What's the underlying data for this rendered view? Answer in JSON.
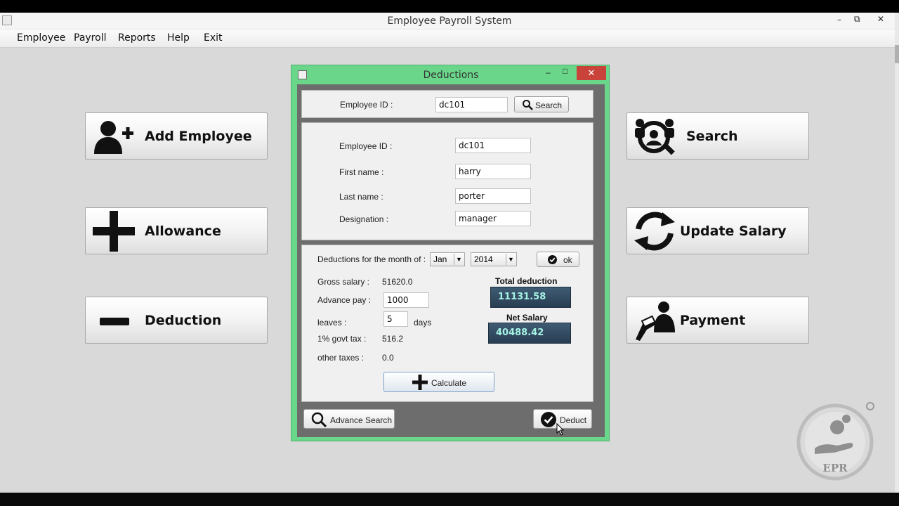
{
  "window": {
    "title": "Employee Payroll System",
    "controls": {
      "minimize": "–",
      "restore": "⧉",
      "close": "✕"
    }
  },
  "menu": {
    "items": [
      "Employee",
      "Payroll",
      "Reports",
      "Help",
      "Exit"
    ]
  },
  "dashboard": {
    "left_buttons": [
      {
        "label": "Add Employee",
        "icon": "add-user-icon"
      },
      {
        "label": "Allowance",
        "icon": "plus-icon"
      },
      {
        "label": "Deduction",
        "icon": "minus-icon"
      }
    ],
    "right_buttons": [
      {
        "label": "Search",
        "icon": "search-people-icon"
      },
      {
        "label": "Update Salary",
        "icon": "refresh-icon"
      },
      {
        "label": "Payment",
        "icon": "payment-icon"
      }
    ]
  },
  "dialog": {
    "title": "Deductions",
    "controls": {
      "minimize": "–",
      "maximize": "□",
      "close": "✕"
    },
    "search_panel": {
      "id_label": "Employee ID :",
      "id_value": "dc101",
      "search_button": "Search"
    },
    "info_panel": {
      "employee_id_label": "Employee ID :",
      "employee_id_value": "dc101",
      "first_name_label": "First name :",
      "first_name_value": "harry",
      "last_name_label": "Last name :",
      "last_name_value": "porter",
      "designation_label": "Designation :",
      "designation_value": "manager"
    },
    "deduction_panel": {
      "month_label": "Deductions  for the month of :",
      "month_value": "Jan",
      "year_value": "2014",
      "ok_button": "ok",
      "gross_label": "Gross salary :",
      "gross_value": "51620.0",
      "advance_label": "Advance pay :",
      "advance_value": "1000",
      "leaves_label": "leaves :",
      "leaves_value": "5",
      "days_label": "days",
      "govt_tax_label": "1% govt tax :",
      "govt_tax_value": "516.2",
      "other_taxes_label": "other taxes :",
      "other_taxes_value": "0.0",
      "calculate_button": "Calculate",
      "total_deduction_label": "Total deduction",
      "total_deduction_value": "11131.58",
      "net_salary_label": "Net Salary",
      "net_salary_value": "40488.42"
    },
    "footer": {
      "advance_search_button": "Advance Search",
      "deduct_button": "Deduct"
    }
  },
  "logo": {
    "text": "EPR"
  }
}
